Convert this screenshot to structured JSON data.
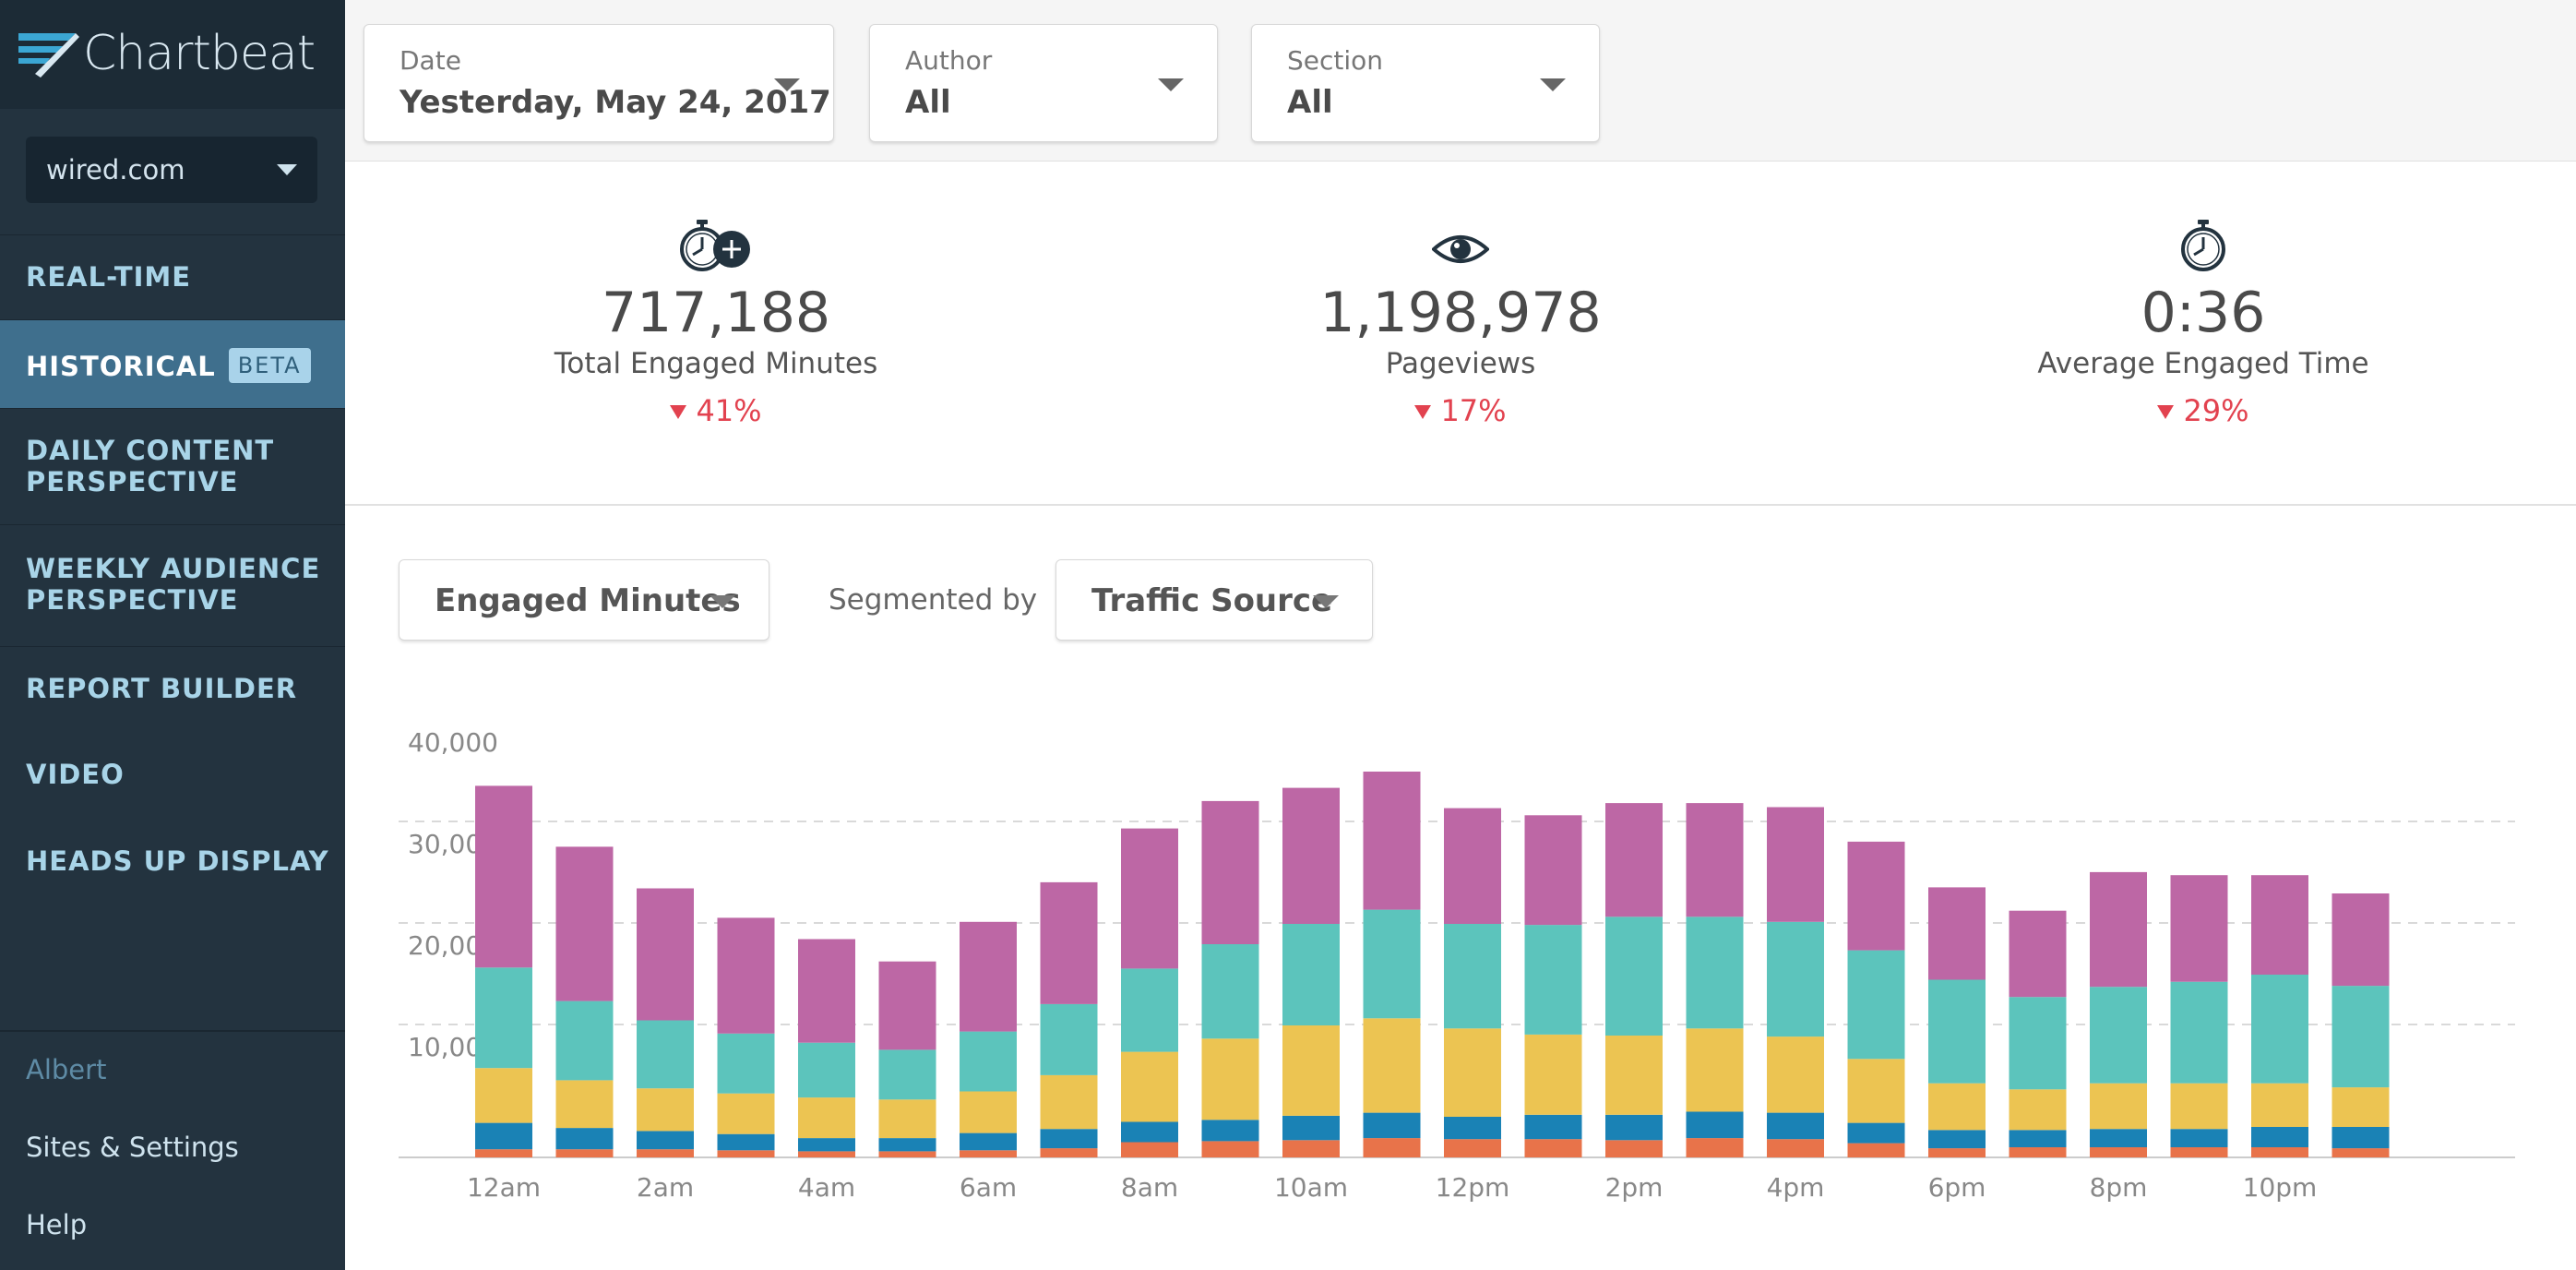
{
  "app": {
    "logo_text": "Chartbeat",
    "brand_color": "#3ba6d3"
  },
  "sidebar": {
    "site_selector": {
      "value": "wired.com",
      "icon": "chevron-down-icon"
    },
    "items": [
      {
        "label": "REAL-TIME"
      },
      {
        "label": "HISTORICAL",
        "badge": "BETA",
        "active": true
      },
      {
        "label_line1": "DAILY CONTENT",
        "label_line2": "PERSPECTIVE"
      },
      {
        "label_line1": "WEEKLY AUDIENCE",
        "label_line2": "PERSPECTIVE"
      },
      {
        "label": "REPORT BUILDER"
      },
      {
        "label": "VIDEO"
      },
      {
        "label": "HEADS UP DISPLAY"
      }
    ],
    "footer": {
      "user": "Albert",
      "settings": "Sites & Settings",
      "help": "Help"
    }
  },
  "filters": {
    "date": {
      "label": "Date",
      "value": "Yesterday, May 24, 2017"
    },
    "author": {
      "label": "Author",
      "value": "All"
    },
    "section": {
      "label": "Section",
      "value": "All"
    }
  },
  "metrics": [
    {
      "value": "717,188",
      "label": "Total Engaged Minutes",
      "change": "41%",
      "direction": "down",
      "icon": "stopwatch-plus-icon"
    },
    {
      "value": "1,198,978",
      "label": "Pageviews",
      "change": "17%",
      "direction": "down",
      "icon": "eye-icon"
    },
    {
      "value": "0:36",
      "label": "Average Engaged Time",
      "change": "29%",
      "direction": "down",
      "icon": "stopwatch-icon"
    }
  ],
  "controls": {
    "metric_select": "Engaged Minutes",
    "segmented_by_label": "Segmented by",
    "segment_select": "Traffic Source"
  },
  "chart_data": {
    "type": "bar",
    "stacked": true,
    "x_tick_labels": [
      "12am",
      "2am",
      "4am",
      "6am",
      "8am",
      "10am",
      "12pm",
      "2pm",
      "4pm",
      "6pm",
      "8pm",
      "10pm"
    ],
    "categories": [
      "12am",
      "1am",
      "2am",
      "3am",
      "4am",
      "5am",
      "6am",
      "7am",
      "8am",
      "9am",
      "10am",
      "11am",
      "12pm",
      "1pm",
      "2pm",
      "3pm",
      "4pm",
      "5pm",
      "6pm",
      "7pm",
      "8pm",
      "9pm",
      "10pm",
      "11pm"
    ],
    "ylim": [
      0,
      40000
    ],
    "y_ticks": [
      10000,
      20000,
      30000,
      40000
    ],
    "y_tick_labels": [
      "10,000",
      "20,000",
      "30,000",
      "40,000"
    ],
    "grid": true,
    "series": [
      {
        "color": "#e8734a",
        "values": [
          800,
          800,
          800,
          700,
          600,
          600,
          700,
          900,
          1500,
          1600,
          1700,
          1900,
          1800,
          1800,
          1700,
          1900,
          1800,
          1400,
          900,
          1000,
          1000,
          1000,
          1000,
          900
        ]
      },
      {
        "color": "#1a82b5",
        "values": [
          2600,
          2100,
          1800,
          1600,
          1300,
          1300,
          1700,
          1900,
          2000,
          2100,
          2400,
          2500,
          2200,
          2400,
          2500,
          2600,
          2600,
          2000,
          1800,
          1700,
          1800,
          1800,
          2000,
          2100
        ]
      },
      {
        "color": "#ecc452",
        "values": [
          5400,
          4700,
          4200,
          4000,
          4000,
          3800,
          4100,
          5300,
          6900,
          8000,
          8900,
          9300,
          8700,
          7900,
          7800,
          8200,
          7500,
          6300,
          4600,
          4000,
          4500,
          4500,
          4300,
          3900
        ]
      },
      {
        "color": "#5cc4bc",
        "values": [
          9900,
          7800,
          6700,
          5900,
          5400,
          4900,
          5900,
          7000,
          8200,
          9300,
          10000,
          10700,
          10300,
          10800,
          11700,
          11000,
          11300,
          10700,
          10200,
          9100,
          9500,
          10000,
          10700,
          10000
        ]
      },
      {
        "color": "#bd67a5",
        "values": [
          17900,
          15200,
          13000,
          11400,
          10200,
          8700,
          10800,
          12000,
          13800,
          14100,
          13400,
          13600,
          11400,
          10800,
          11200,
          11200,
          11300,
          10700,
          9100,
          8500,
          11300,
          10500,
          9800,
          9100
        ]
      }
    ]
  }
}
